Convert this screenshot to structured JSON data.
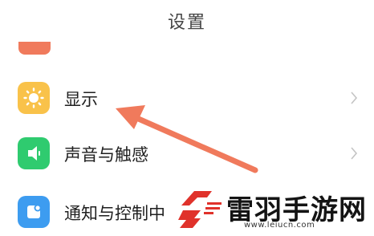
{
  "header": {
    "title": "设置"
  },
  "settings_items": [
    {
      "id": "display",
      "label": "显示",
      "icon": "sun-icon",
      "color": "#f9c24a"
    },
    {
      "id": "sound",
      "label": "声音与触感",
      "icon": "speaker-icon",
      "color": "#2fcb6f"
    },
    {
      "id": "notifications",
      "label": "通知与控制中",
      "icon": "notification-icon",
      "color": "#3d9cf0"
    }
  ],
  "annotation": {
    "icon": "pointer-arrow",
    "color": "#f07a5c"
  },
  "watermark": {
    "title": "雷羽手游网",
    "url": "www.leiucn.com",
    "logo_color": "#e0322b"
  }
}
